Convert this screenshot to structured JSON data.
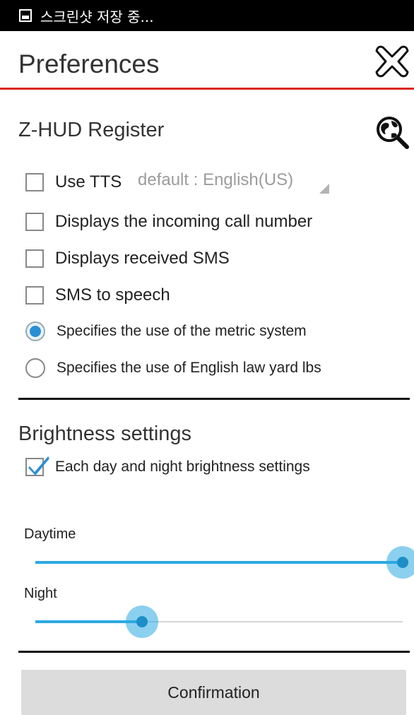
{
  "status_bar": {
    "icon": "screenshot-icon",
    "text": "스크린샷 저장 중..."
  },
  "header": {
    "title": "Preferences",
    "close_icon": "close-icon"
  },
  "colors": {
    "accent_divider": "#d9261c",
    "slider": "#2ba9e1",
    "radio_selected": "#2a8fd2",
    "check": "#2a8fd2"
  },
  "register": {
    "title": "Z-HUD Register",
    "search_icon": "globe-search-icon",
    "options": [
      {
        "type": "checkbox",
        "label": "Use TTS",
        "checked": false
      },
      {
        "type": "checkbox",
        "label": "Displays the incoming call number",
        "checked": false
      },
      {
        "type": "checkbox",
        "label": "Displays received SMS",
        "checked": false
      },
      {
        "type": "checkbox",
        "label": "SMS to speech",
        "checked": false
      },
      {
        "type": "radio",
        "label": "Specifies the use of the metric system",
        "selected": true
      },
      {
        "type": "radio",
        "label": "Specifies the use of English law yard lbs",
        "selected": false
      }
    ],
    "tts_spinner": "default : English(US)"
  },
  "brightness": {
    "title": "Brightness settings",
    "each_day_night": {
      "label": "Each day and night brightness settings",
      "checked": true
    },
    "daytime": {
      "label": "Daytime",
      "value_percent": 100
    },
    "night": {
      "label": "Night",
      "value_percent": 29
    }
  },
  "confirm_button": "Confirmation"
}
